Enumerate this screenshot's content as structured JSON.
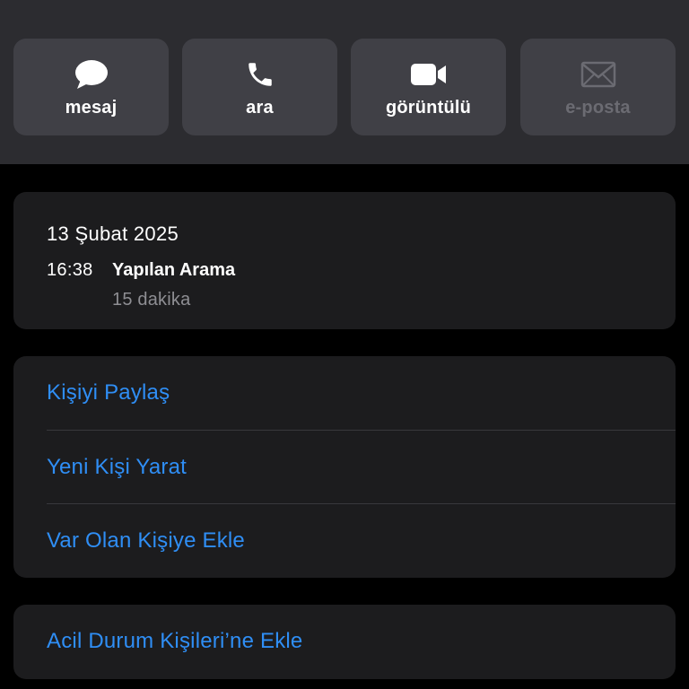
{
  "quick_actions": [
    {
      "label": "mesaj",
      "icon": "message-bubble-icon",
      "enabled": true
    },
    {
      "label": "ara",
      "icon": "phone-icon",
      "enabled": true
    },
    {
      "label": "görüntülü",
      "icon": "video-camera-icon",
      "enabled": true
    },
    {
      "label": "e-posta",
      "icon": "envelope-icon",
      "enabled": false
    }
  ],
  "recent_call": {
    "date": "13 Şubat 2025",
    "time": "16:38",
    "type": "Yapılan Arama",
    "duration": "15 dakika"
  },
  "contact_actions": [
    {
      "label": "Kişiyi Paylaş"
    },
    {
      "label": "Yeni Kişi Yarat"
    },
    {
      "label": "Var Olan Kişiye Ekle"
    }
  ],
  "emergency": {
    "label": "Acil Durum Kişileri’ne Ekle"
  },
  "colors": {
    "accent": "#2f8ef5",
    "background": "#000000",
    "card": "#1c1c1e",
    "header": "#2c2c30",
    "button": "#404046",
    "secondary_text": "#8e8e93",
    "disabled_text": "#6b6b72"
  }
}
